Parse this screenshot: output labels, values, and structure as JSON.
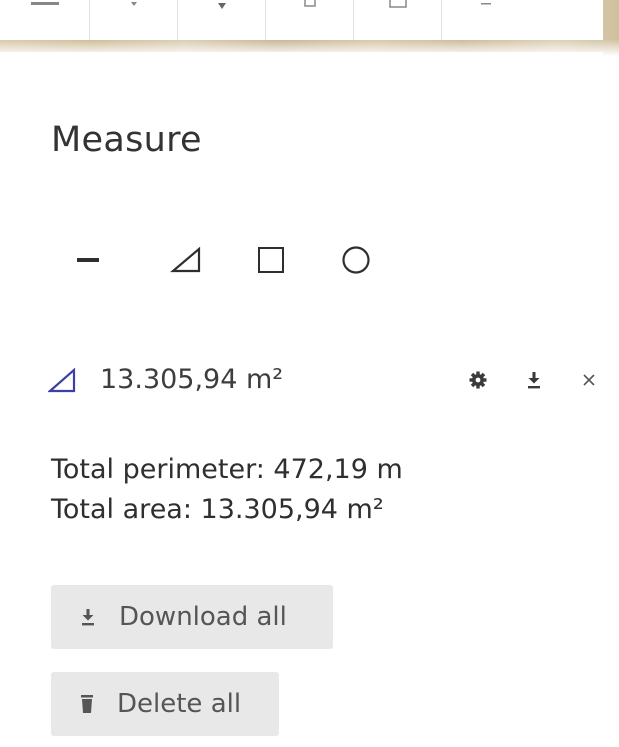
{
  "panel": {
    "title": "Measure"
  },
  "modes": [
    {
      "icon": "line-measure-icon"
    },
    {
      "icon": "polygon-measure-icon"
    },
    {
      "icon": "rectangle-measure-icon"
    },
    {
      "icon": "circle-measure-icon"
    }
  ],
  "result": {
    "icon": "polygon-measure-icon",
    "value": "13.305,94 m²",
    "actions": [
      "settings-icon",
      "download-icon",
      "close-icon"
    ]
  },
  "summary": {
    "perimeter": "Total perimeter: 472,19 m",
    "area": "Total area: 13.305,94 m²"
  },
  "buttons": {
    "download_all": "Download all",
    "delete_all": "Delete all"
  },
  "colors": {
    "accent": "#3d3fa8",
    "button_bg": "#e8e8e8",
    "text": "#333333"
  }
}
